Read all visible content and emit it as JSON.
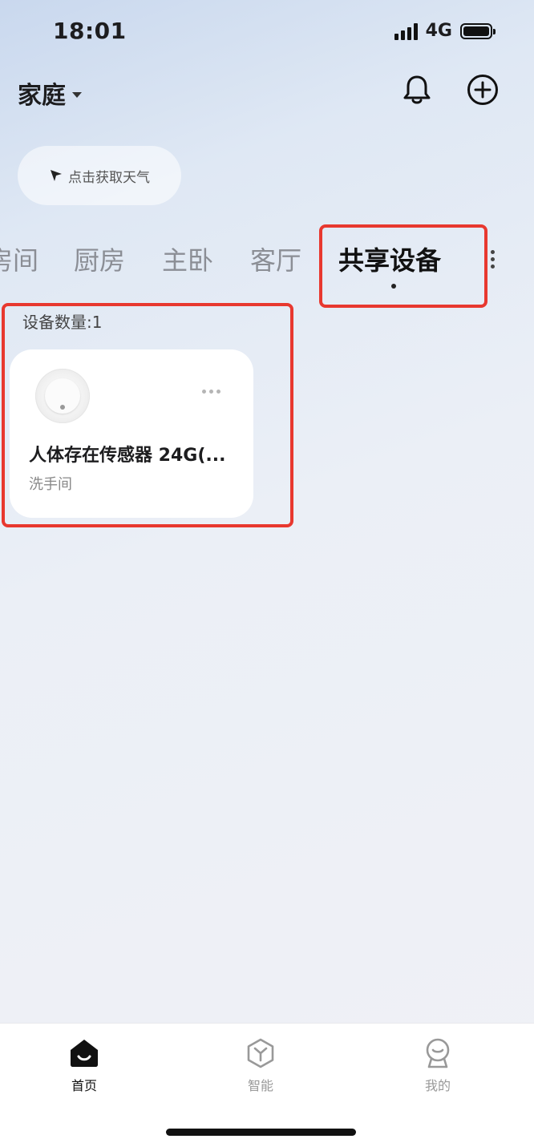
{
  "status_bar": {
    "time": "18:01",
    "network": "4G"
  },
  "header": {
    "home_name": "家庭"
  },
  "weather": {
    "label": "点击获取天气"
  },
  "room_tabs": [
    {
      "label": "房间"
    },
    {
      "label": "厨房"
    },
    {
      "label": "主卧"
    },
    {
      "label": "客厅"
    },
    {
      "label": "共享设备",
      "active": true
    }
  ],
  "device_count_label": "设备数量:1",
  "devices": [
    {
      "name": "人体存在传感器 24G(...",
      "room": "洗手间"
    }
  ],
  "bottom_nav": [
    {
      "label": "首页",
      "icon": "home-icon",
      "active": true
    },
    {
      "label": "智能",
      "icon": "smart-icon"
    },
    {
      "label": "我的",
      "icon": "profile-icon"
    }
  ],
  "colors": {
    "highlight": "#e8382f",
    "active_text": "#111111",
    "inactive_text": "#8b8e95"
  }
}
